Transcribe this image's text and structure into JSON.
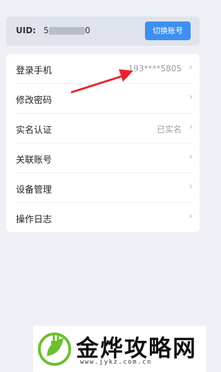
{
  "account": {
    "uid_label": "UID:",
    "uid_prefix": "5",
    "uid_suffix": "0",
    "switch_button_label": "切换账号"
  },
  "settings": {
    "items": [
      {
        "label": "登录手机",
        "value": "193****5805"
      },
      {
        "label": "修改密码",
        "value": ""
      },
      {
        "label": "实名认证",
        "value": "已实名"
      },
      {
        "label": "关联账号",
        "value": ""
      },
      {
        "label": "设备管理",
        "value": ""
      },
      {
        "label": "操作日志",
        "value": ""
      }
    ],
    "chevron": "›"
  },
  "watermark": {
    "name": "金烨攻略网",
    "url": "www.jykz.com.cn"
  },
  "colors": {
    "accent": "#3e8ff0",
    "annotation_arrow": "#e8242b",
    "logo_green": "#6cbf2e"
  }
}
